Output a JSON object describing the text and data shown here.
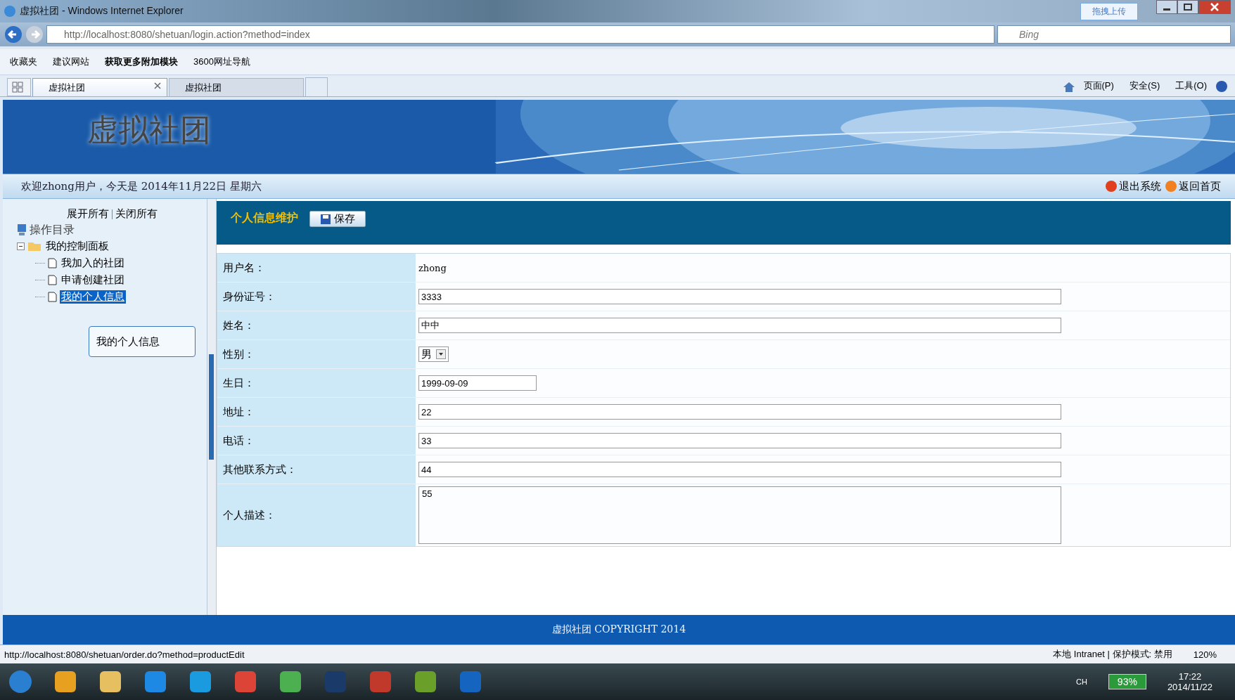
{
  "window": {
    "title": "虚拟社团 - Windows Internet Explorer",
    "upload_button": "拖拽上传"
  },
  "address_bar": {
    "url": "http://localhost:8080/shetuan/login.action?method=index",
    "search_placeholder": "Bing"
  },
  "favorites_bar": [
    {
      "label": "收藏夹"
    },
    {
      "label": "建议网站"
    },
    {
      "label": "获取更多附加模块"
    },
    {
      "label": "3600网址导航"
    }
  ],
  "tabs": [
    {
      "label": "虚拟社团",
      "selected": true
    },
    {
      "label": "虚拟社团",
      "selected": false
    }
  ],
  "command_bar": [
    "页面(P)",
    "安全(S)",
    "工具(O)"
  ],
  "page": {
    "site_title": "虚拟社团",
    "welcome": "欢迎zhong用户，今天是 2014年11月22日 星期六",
    "logout": "退出系统",
    "home": "返回首页",
    "expand_all": "展开所有",
    "collapse_all": "关闭所有",
    "tree_root": "操作目录",
    "tree": [
      {
        "label": "我的控制面板",
        "expanded": true,
        "children": [
          {
            "label": "我加入的社团",
            "selected": false
          },
          {
            "label": "申请创建社团",
            "selected": false
          },
          {
            "label": "我的个人信息",
            "selected": true
          }
        ]
      }
    ],
    "tooltip": "我的个人信息",
    "form_title": "个人信息维护",
    "save_button": "保存",
    "fields": [
      {
        "label": "用户名：",
        "kind": "text",
        "value": "zhong"
      },
      {
        "label": "身份证号：",
        "kind": "input",
        "value": "3333"
      },
      {
        "label": "姓名：",
        "kind": "input",
        "value": "中中"
      },
      {
        "label": "性别：",
        "kind": "select",
        "value": "男"
      },
      {
        "label": "生日：",
        "kind": "date",
        "value": "1999-09-09"
      },
      {
        "label": "地址：",
        "kind": "input",
        "value": "22"
      },
      {
        "label": "电话：",
        "kind": "input",
        "value": "33"
      },
      {
        "label": "其他联系方式：",
        "kind": "input",
        "value": "44"
      },
      {
        "label": "个人描述：",
        "kind": "textarea",
        "value": "55"
      }
    ],
    "footer": "虚拟社团 COPYRIGHT 2014"
  },
  "status_bar": {
    "url": "http://localhost:8080/shetuan/order.do?method=productEdit",
    "zone": "本地 Intranet | 保护模式: 禁用",
    "zoom": "120%"
  },
  "taskbar": {
    "ime": "CH",
    "battery": "93%",
    "time": "17:22",
    "date": "2014/11/22"
  }
}
